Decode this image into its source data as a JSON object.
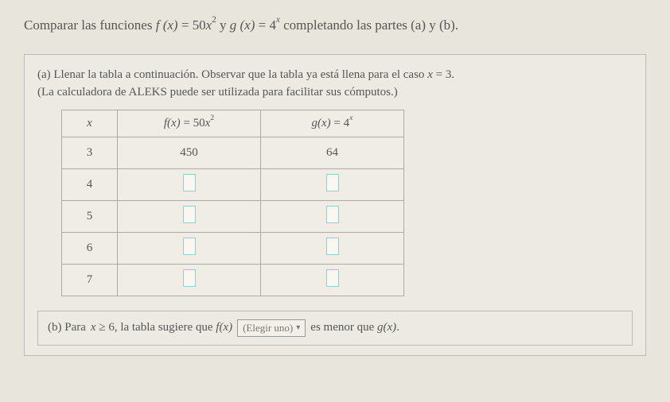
{
  "prompt": {
    "prefix": "Comparar las funciones ",
    "f_name": "f",
    "paren_x": "(x)",
    "eq": " = ",
    "f_coeff": "50",
    "f_var": "x",
    "f_exp": "2",
    "and": " y ",
    "g_name": "g",
    "g_base": "4",
    "g_exp": "x",
    "suffix": " completando las partes (a) y (b)."
  },
  "part_a": {
    "line1_prefix": "(a) Llenar la tabla a continuación. Observar que la tabla ya está llena para el caso ",
    "line1_eq_lhs": "x",
    "line1_eq_rhs": "3",
    "line1_period": ".",
    "line2": "(La calculadora de ALEKS puede ser utilizada para facilitar sus cómputos.)"
  },
  "table": {
    "headers": {
      "x": "x",
      "fx_name": "f",
      "fx_paren": "(x)",
      "fx_eq": " = ",
      "fx_coeff": "50",
      "fx_var": "x",
      "fx_exp": "2",
      "gx_name": "g",
      "gx_paren": "(x)",
      "gx_eq": " = ",
      "gx_base": "4",
      "gx_exp": "x"
    },
    "rows": [
      {
        "x": "3",
        "fx": "450",
        "gx": "64",
        "filled": true
      },
      {
        "x": "4",
        "fx": "",
        "gx": "",
        "filled": false
      },
      {
        "x": "5",
        "fx": "",
        "gx": "",
        "filled": false
      },
      {
        "x": "6",
        "fx": "",
        "gx": "",
        "filled": false
      },
      {
        "x": "7",
        "fx": "",
        "gx": "",
        "filled": false
      }
    ]
  },
  "part_b": {
    "prefix": "(b) Para ",
    "var": "x",
    "ge": "≥",
    "threshold": "6",
    "mid": ", la tabla sugiere que ",
    "f_name": "f",
    "paren_x": "(x)",
    "dropdown_label": "(Elegir uno)",
    "suffix1": "es menor que ",
    "g_name": "g",
    "period": "."
  }
}
